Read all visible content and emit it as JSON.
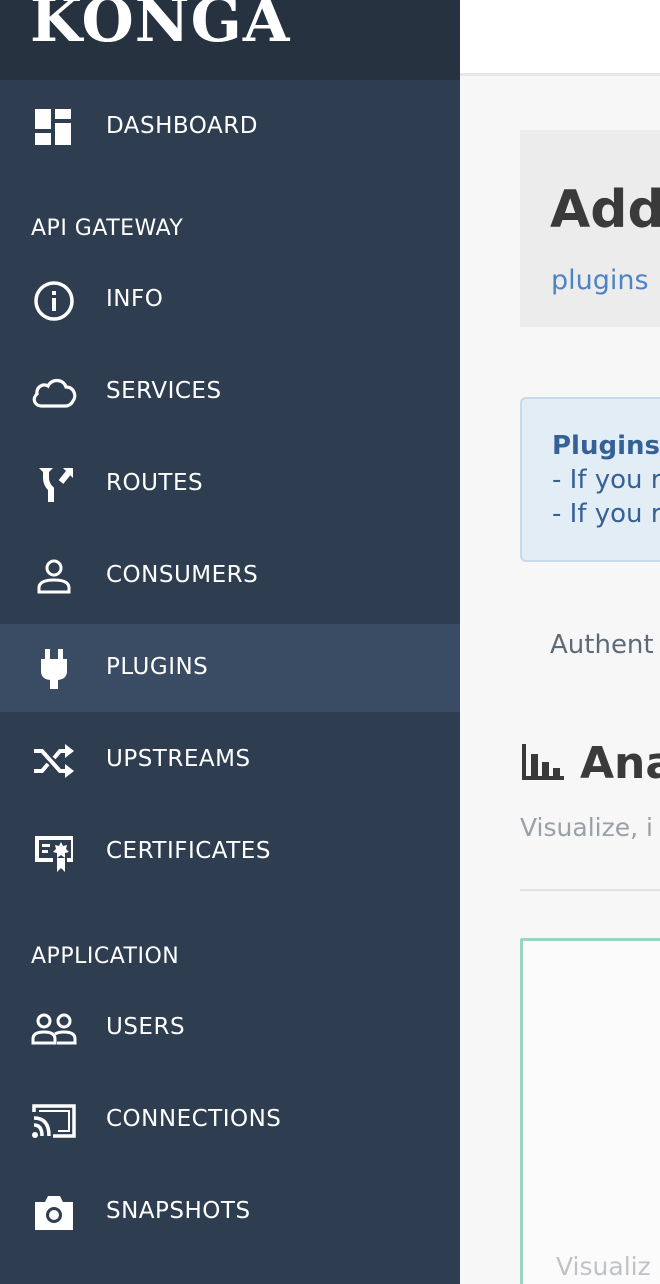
{
  "brand": {
    "name": "KONGA"
  },
  "sidebar": {
    "dashboard": {
      "label": "DASHBOARD",
      "icon": "dashboard-icon"
    },
    "sections": {
      "api_gateway": "API GATEWAY",
      "application": "APPLICATION"
    },
    "api_items": [
      {
        "label": "INFO",
        "icon": "info-icon"
      },
      {
        "label": "SERVICES",
        "icon": "cloud-icon"
      },
      {
        "label": "ROUTES",
        "icon": "routes-icon"
      },
      {
        "label": "CONSUMERS",
        "icon": "person-icon"
      },
      {
        "label": "PLUGINS",
        "icon": "plug-icon",
        "active": true
      },
      {
        "label": "UPSTREAMS",
        "icon": "shuffle-icon"
      },
      {
        "label": "CERTIFICATES",
        "icon": "certificate-icon"
      }
    ],
    "app_items": [
      {
        "label": "USERS",
        "icon": "users-icon"
      },
      {
        "label": "CONNECTIONS",
        "icon": "cast-icon"
      },
      {
        "label": "SNAPSHOTS",
        "icon": "camera-icon"
      }
    ]
  },
  "main": {
    "title": "Add",
    "breadcrumb": "plugins",
    "alert": {
      "title": "Plugins",
      "line1": "- If you r",
      "line2": "- If you r"
    },
    "tab_label": "Authent",
    "section": {
      "title": "Ana",
      "icon": "bar-chart-icon",
      "subtitle": "Visualize, i"
    },
    "card_footer": "Visualiz"
  },
  "colors": {
    "sidebar_bg": "#2e3e50",
    "brand_bg": "#26323f",
    "active_bg": "#394c63",
    "link": "#4f84c4",
    "alert_text": "#356197",
    "card_border": "#9ad6c3"
  }
}
